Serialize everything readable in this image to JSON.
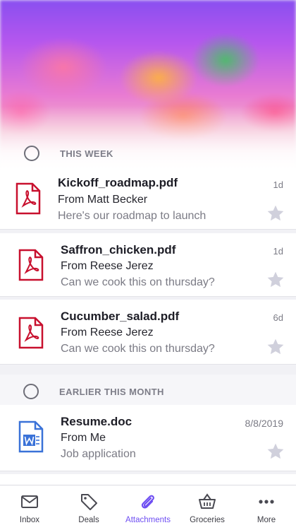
{
  "sections": [
    {
      "title": "THIS WEEK",
      "items": [
        {
          "name": "Kickoff_roadmap.pdf",
          "from": "From Matt Becker",
          "snippet": "Here's our roadmap to launch",
          "date": "1d",
          "type": "pdf"
        },
        {
          "name": "Saffron_chicken.pdf",
          "from": "From Reese Jerez",
          "snippet": "Can we cook this on thursday?",
          "date": "1d",
          "type": "pdf"
        },
        {
          "name": "Cucumber_salad.pdf",
          "from": "From Reese Jerez",
          "snippet": "Can we cook this on thursday?",
          "date": "6d",
          "type": "pdf"
        }
      ]
    },
    {
      "title": "EARLIER THIS MONTH",
      "items": [
        {
          "name": "Resume.doc",
          "from": "From Me",
          "snippet": "Job application",
          "date": "8/8/2019",
          "type": "doc"
        }
      ]
    }
  ],
  "tabs": [
    {
      "label": "Inbox",
      "icon": "inbox-icon"
    },
    {
      "label": "Deals",
      "icon": "tag-icon"
    },
    {
      "label": "Attachments",
      "icon": "paperclip-icon",
      "active": true
    },
    {
      "label": "Groceries",
      "icon": "basket-icon"
    },
    {
      "label": "More",
      "icon": "more-icon"
    }
  ],
  "colors": {
    "pdf": "#c8102e",
    "doc": "#3a72d8",
    "accent": "#6e4ef2",
    "star": "#d0d0dc"
  }
}
